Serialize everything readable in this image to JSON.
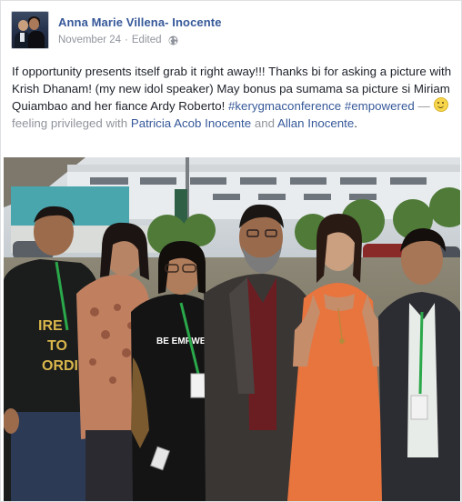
{
  "post": {
    "author": "Anna Marie Villena- Inocente",
    "date": "November 24",
    "edited": "Edited",
    "separator": "·",
    "audience_icon": "globe-icon",
    "text_main": "If opportunity presents itself grab it right away!!! Thanks bi for asking a picture with Krish Dhanam! (my new idol speaker) May bonus pa sumama sa picture si Miriam Quiambao and her fiance Ardy Roberto! ",
    "hashtags": [
      "#kerygmaconference",
      "#empowered"
    ],
    "feeling_prefix": " — ",
    "feeling_icon": "smile-emoji-icon",
    "feeling_text": "feeling privileged with ",
    "tagged": [
      "Patricia Acob Inocente",
      "Allan Inocente"
    ],
    "and": " and ",
    "end": "."
  },
  "photo": {
    "shirt_text_1": "IRE",
    "shirt_text_2": "TO",
    "shirt_text_3": "ORDI",
    "shirt_text_4": "BE EMPWE"
  },
  "colors": {
    "link": "#365899",
    "meta": "#90949c",
    "text": "#1d2129",
    "orange_dress": "#e8743e",
    "lanyard": "#2aa84a"
  }
}
